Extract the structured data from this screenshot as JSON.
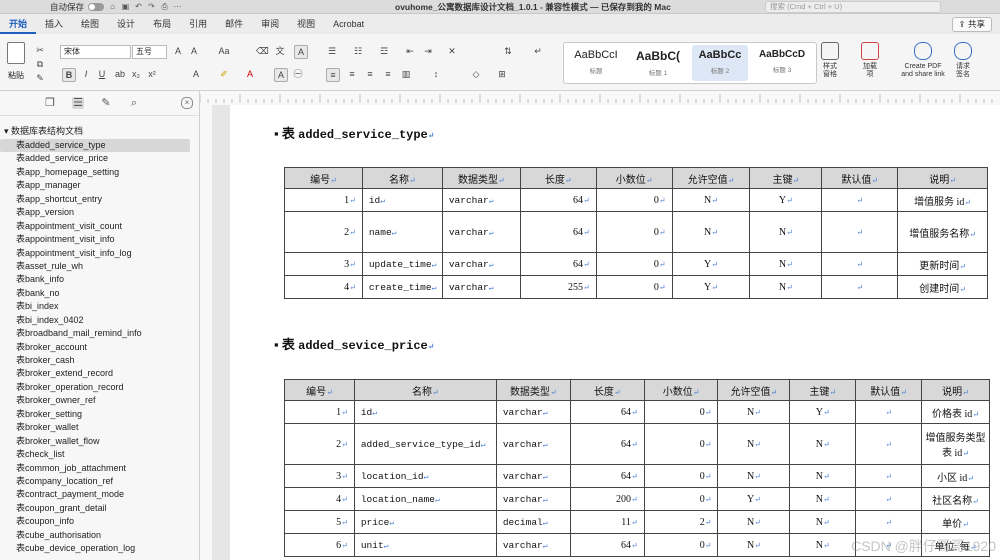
{
  "titlebar": {
    "autosave": "自动保存",
    "title": "ovuhome_公寓数据库设计文档_1.0.1 - 兼容性模式 — 已保存到我的 Mac",
    "search_placeholder": "搜索 (Cmd + Ctrl + U)"
  },
  "tabs": [
    "开始",
    "插入",
    "绘图",
    "设计",
    "布局",
    "引用",
    "邮件",
    "审阅",
    "视图",
    "Acrobat"
  ],
  "share": "共享",
  "ribbon": {
    "paste": "粘贴",
    "font": "宋体",
    "size": "五号",
    "styles": [
      {
        "preview": "AaBbCcI",
        "label": "标题"
      },
      {
        "preview": "AaBbC(",
        "label": "标题 1"
      },
      {
        "preview": "AaBbCc",
        "label": "标题 2"
      },
      {
        "preview": "AaBbCcD",
        "label": "标题 3"
      }
    ],
    "style_pane": "样式\n窗格",
    "dictate": "加载\n项",
    "create_pdf": "Create PDF\nand share link",
    "request_sign": "请求\n签名"
  },
  "sidebar": {
    "root": "数据库表结构文档",
    "items": [
      "表added_service_type",
      "表added_service_price",
      "表app_homepage_setting",
      "表app_manager",
      "表app_shortcut_entry",
      "表app_version",
      "表appointment_visit_count",
      "表appointment_visit_info",
      "表appointment_visit_info_log",
      "表asset_rule_wh",
      "表bank_info",
      "表bank_no",
      "表bi_index",
      "表bi_index_0402",
      "表broadband_mail_remind_info",
      "表broker_account",
      "表broker_cash",
      "表broker_extend_record",
      "表broker_operation_record",
      "表broker_owner_ref",
      "表broker_setting",
      "表broker_wallet",
      "表broker_wallet_flow",
      "表check_list",
      "表common_job_attachment",
      "表company_location_ref",
      "表contract_payment_mode",
      "表coupon_grant_detail",
      "表coupon_info",
      "表cube_authorisation",
      "表cube_device_operation_log"
    ]
  },
  "doc": {
    "t1": {
      "prefix": "表",
      "name": "added_service_type",
      "headers": [
        "编号",
        "名称",
        "数据类型",
        "长度",
        "小数位",
        "允许空值",
        "主键",
        "默认值",
        "说明"
      ],
      "rows": [
        [
          "1",
          "id",
          "varchar",
          "64",
          "0",
          "N",
          "Y",
          "",
          "增值服务 id"
        ],
        [
          "2",
          "name",
          "varchar",
          "64",
          "0",
          "N",
          "N",
          "",
          "增值服务名称"
        ],
        [
          "3",
          "update_time",
          "varchar",
          "64",
          "0",
          "Y",
          "N",
          "",
          "更新时间"
        ],
        [
          "4",
          "create_time",
          "varchar",
          "255",
          "0",
          "Y",
          "N",
          "",
          "创建时间"
        ]
      ]
    },
    "t2": {
      "prefix": "表",
      "name": "added_sevice_price",
      "headers": [
        "编号",
        "名称",
        "数据类型",
        "长度",
        "小数位",
        "允许空值",
        "主键",
        "默认值",
        "说明"
      ],
      "rows": [
        [
          "1",
          "id",
          "varchar",
          "64",
          "0",
          "N",
          "Y",
          "",
          "价格表 id"
        ],
        [
          "2",
          "added_service_type_id",
          "varchar",
          "64",
          "0",
          "N",
          "N",
          "",
          "增值服务类型表 id"
        ],
        [
          "3",
          "location_id",
          "varchar",
          "64",
          "0",
          "N",
          "N",
          "",
          "小区 id"
        ],
        [
          "4",
          "location_name",
          "varchar",
          "200",
          "0",
          "Y",
          "N",
          "",
          "社区名称"
        ],
        [
          "5",
          "price",
          "decimal",
          "11",
          "2",
          "N",
          "N",
          "",
          "单价"
        ],
        [
          "6",
          "unit",
          "varchar",
          "64",
          "0",
          "N",
          "N",
          "",
          "单位: 每"
        ]
      ]
    }
  },
  "watermark": "CSDN @胖仔哥哥1920"
}
